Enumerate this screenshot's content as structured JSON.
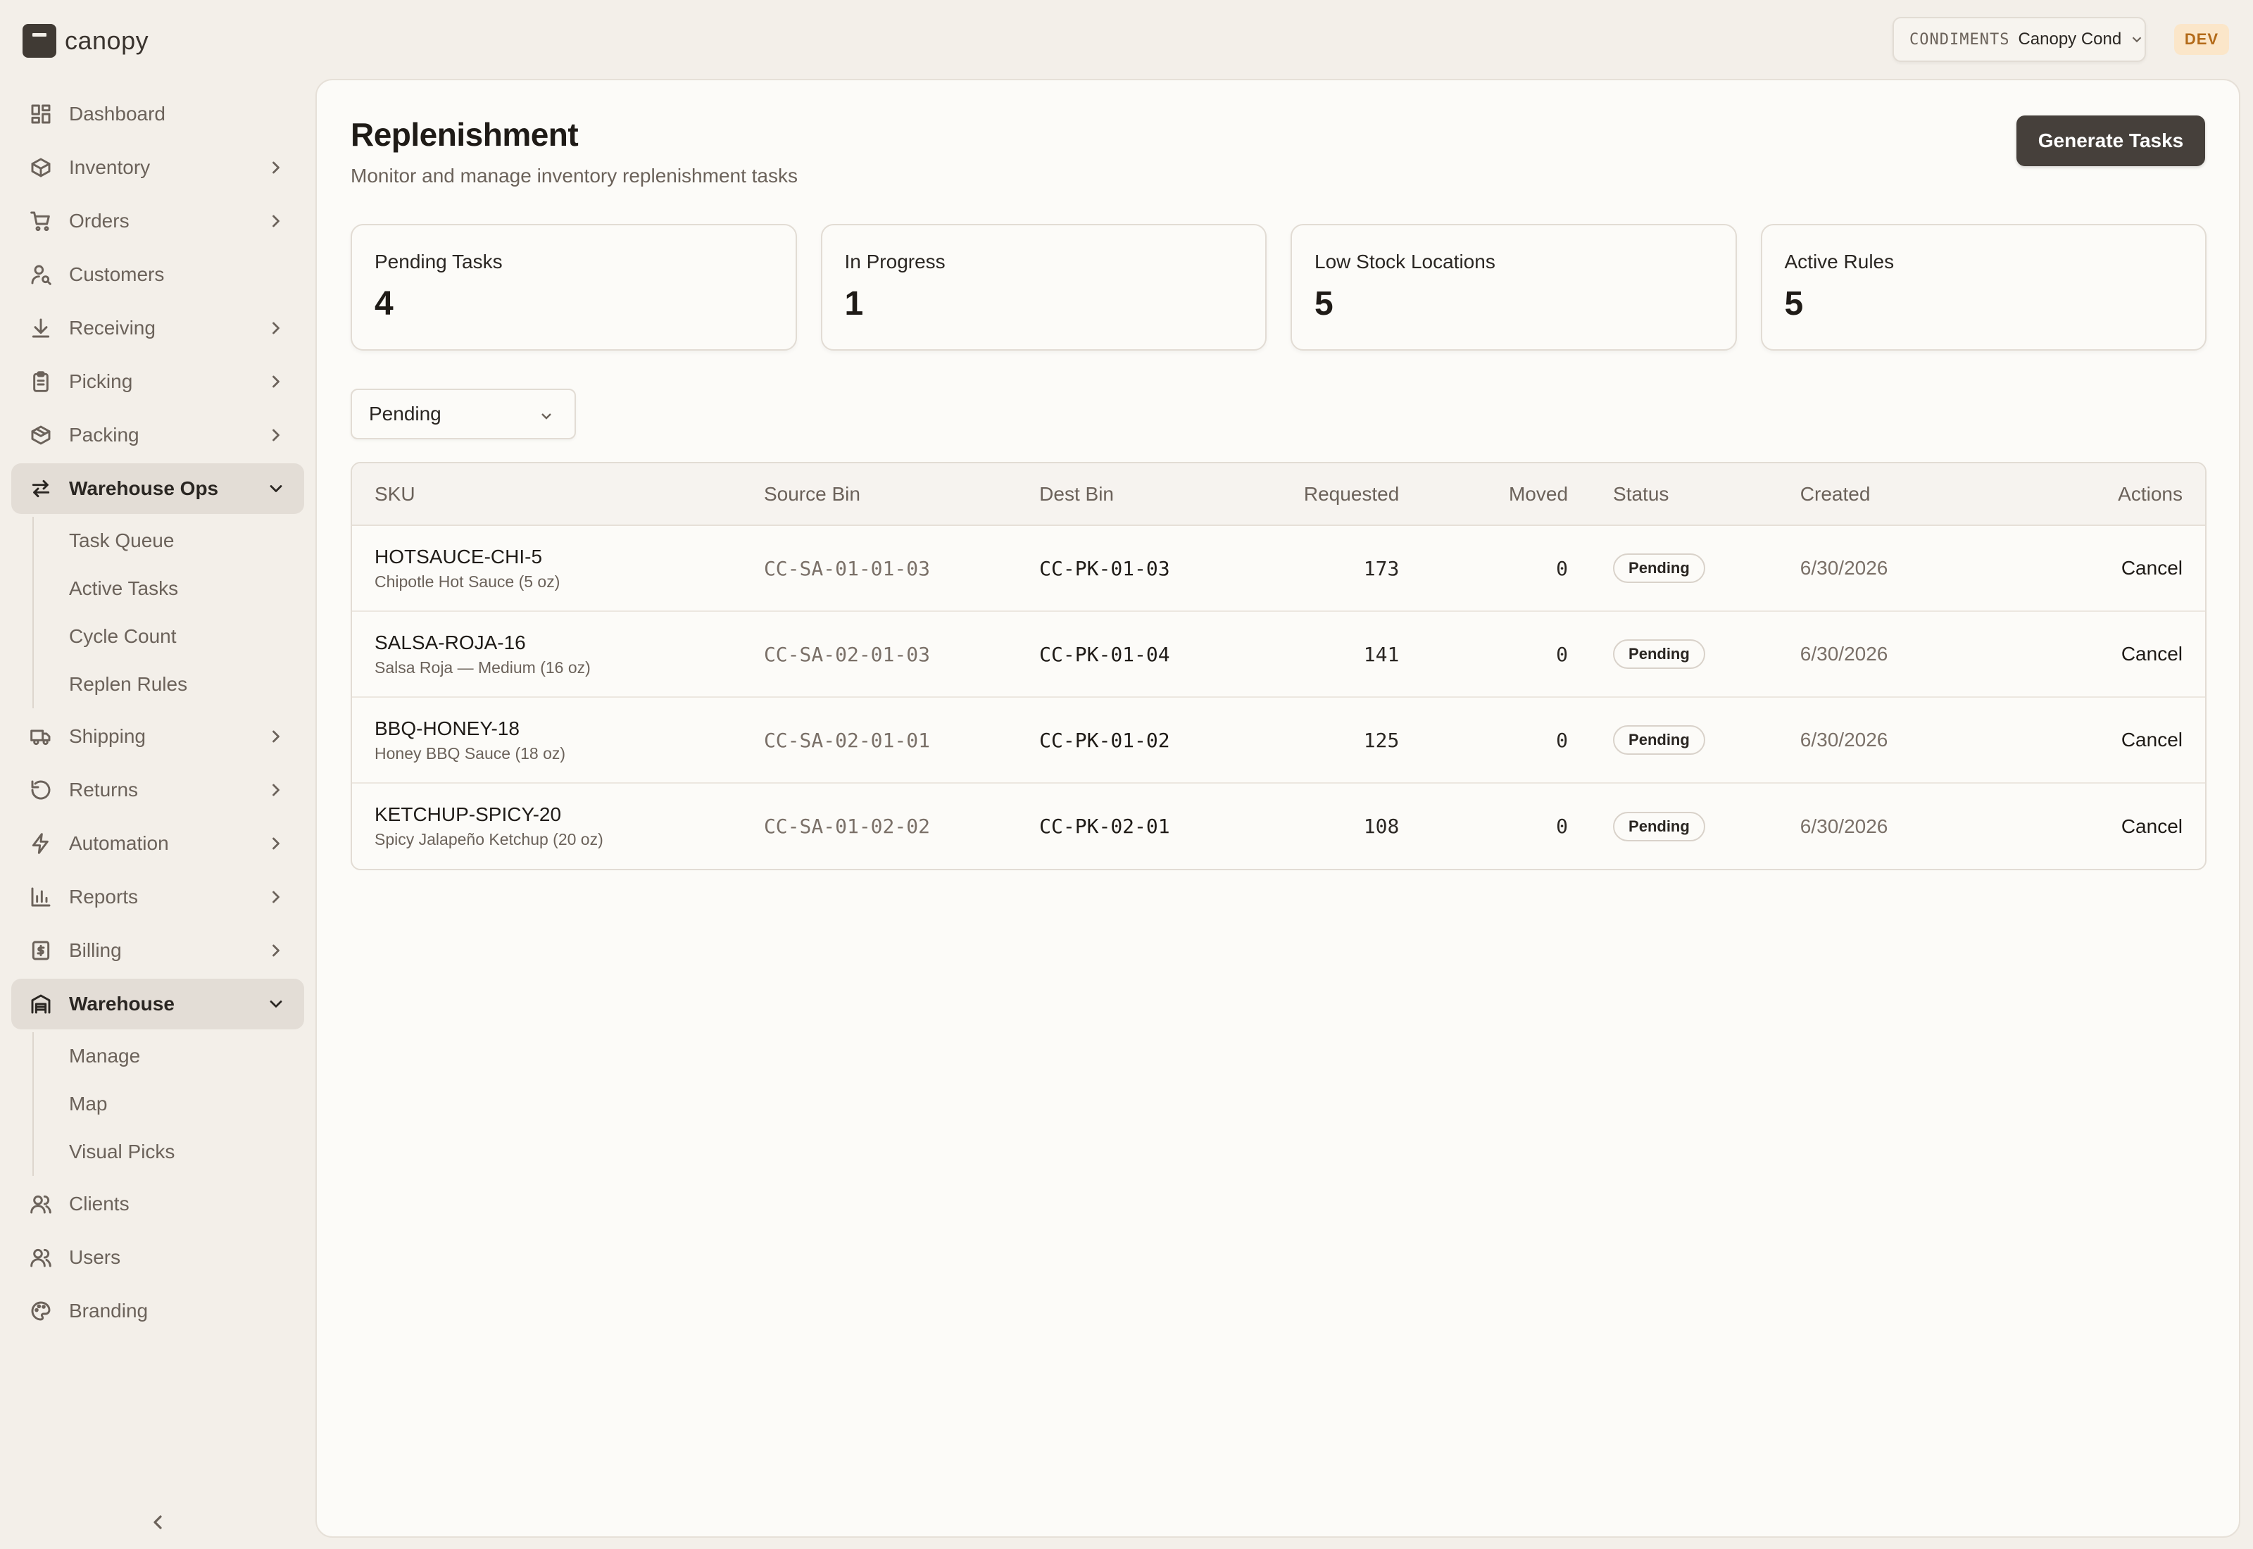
{
  "brand": {
    "name": "canopy"
  },
  "topbar": {
    "org_code": "CONDIMENTS",
    "org_name": "Canopy Cond",
    "env_badge": "DEV"
  },
  "sidebar": {
    "items": [
      {
        "label": "Dashboard",
        "icon": "dashboard-icon"
      },
      {
        "label": "Inventory",
        "icon": "box-icon"
      },
      {
        "label": "Orders",
        "icon": "cart-icon"
      },
      {
        "label": "Customers",
        "icon": "user-search-icon"
      },
      {
        "label": "Receiving",
        "icon": "download-icon"
      },
      {
        "label": "Picking",
        "icon": "clipboard-icon"
      },
      {
        "label": "Packing",
        "icon": "package-icon"
      },
      {
        "label": "Warehouse Ops",
        "icon": "arrows-swap-icon",
        "expanded": true,
        "children": [
          "Task Queue",
          "Active Tasks",
          "Cycle Count",
          "Replen Rules"
        ]
      },
      {
        "label": "Shipping",
        "icon": "truck-icon"
      },
      {
        "label": "Returns",
        "icon": "rotate-ccw-icon"
      },
      {
        "label": "Automation",
        "icon": "bolt-icon"
      },
      {
        "label": "Reports",
        "icon": "bar-chart-icon"
      },
      {
        "label": "Billing",
        "icon": "receipt-icon"
      },
      {
        "label": "Warehouse",
        "icon": "warehouse-icon",
        "expanded": true,
        "children": [
          "Manage",
          "Map",
          "Visual Picks"
        ]
      },
      {
        "label": "Clients",
        "icon": "users-icon"
      },
      {
        "label": "Users",
        "icon": "users-icon"
      },
      {
        "label": "Branding",
        "icon": "palette-icon"
      }
    ]
  },
  "page": {
    "title": "Replenishment",
    "subtitle": "Monitor and manage inventory replenishment tasks",
    "primary_action": "Generate Tasks"
  },
  "stats": [
    {
      "label": "Pending Tasks",
      "value": "4"
    },
    {
      "label": "In Progress",
      "value": "1"
    },
    {
      "label": "Low Stock Locations",
      "value": "5"
    },
    {
      "label": "Active Rules",
      "value": "5"
    }
  ],
  "filter": {
    "selected": "Pending"
  },
  "table": {
    "headers": [
      "SKU",
      "Source Bin",
      "Dest Bin",
      "Requested",
      "Moved",
      "Status",
      "Created",
      "Actions"
    ],
    "rows": [
      {
        "sku": "HOTSAUCE-CHI-5",
        "name": "Chipotle Hot Sauce (5 oz)",
        "source": "CC-SA-01-01-03",
        "dest": "CC-PK-01-03",
        "requested": "173",
        "moved": "0",
        "status": "Pending",
        "created": "6/30/2026",
        "action": "Cancel"
      },
      {
        "sku": "SALSA-ROJA-16",
        "name": "Salsa Roja — Medium (16 oz)",
        "source": "CC-SA-02-01-03",
        "dest": "CC-PK-01-04",
        "requested": "141",
        "moved": "0",
        "status": "Pending",
        "created": "6/30/2026",
        "action": "Cancel"
      },
      {
        "sku": "BBQ-HONEY-18",
        "name": "Honey BBQ Sauce (18 oz)",
        "source": "CC-SA-02-01-01",
        "dest": "CC-PK-01-02",
        "requested": "125",
        "moved": "0",
        "status": "Pending",
        "created": "6/30/2026",
        "action": "Cancel"
      },
      {
        "sku": "KETCHUP-SPICY-20",
        "name": "Spicy Jalapeño Ketchup (20 oz)",
        "source": "CC-SA-01-02-02",
        "dest": "CC-PK-02-01",
        "requested": "108",
        "moved": "0",
        "status": "Pending",
        "created": "6/30/2026",
        "action": "Cancel"
      }
    ]
  }
}
